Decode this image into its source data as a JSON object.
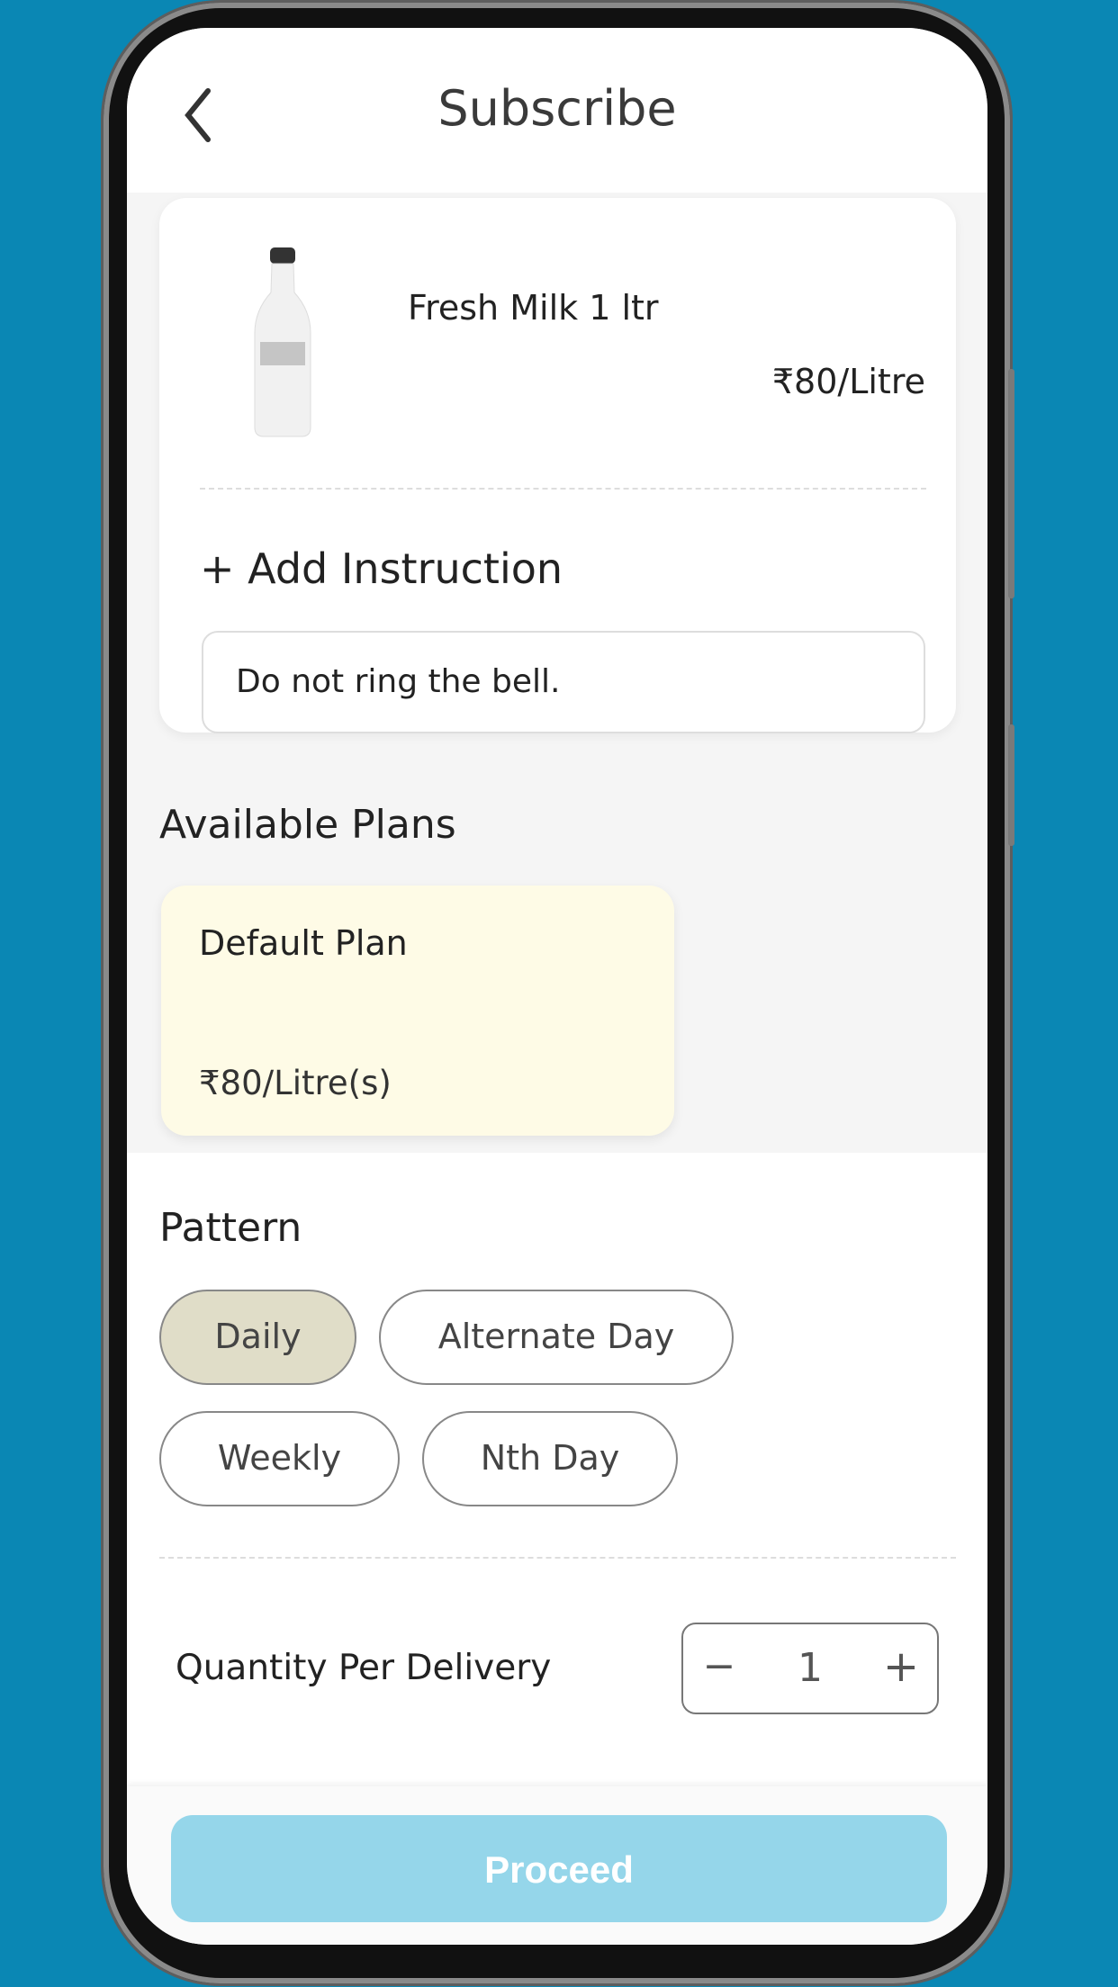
{
  "header": {
    "title": "Subscribe",
    "back_icon": "chevron-left-icon"
  },
  "product": {
    "name": "Fresh Milk 1 ltr",
    "price": "₹80/Litre",
    "image": "milk-bottle"
  },
  "instruction": {
    "add_label": "+ Add Instruction",
    "value": "Do not ring the bell."
  },
  "plans": {
    "heading": "Available Plans",
    "items": [
      {
        "name": "Default Plan",
        "price": "₹80/Litre(s)",
        "selected": true
      }
    ]
  },
  "pattern": {
    "heading": "Pattern",
    "options": [
      {
        "label": "Daily",
        "selected": true
      },
      {
        "label": "Alternate Day",
        "selected": false
      },
      {
        "label": "Weekly",
        "selected": false
      },
      {
        "label": "Nth Day",
        "selected": false
      }
    ]
  },
  "quantity": {
    "label": "Quantity Per Delivery",
    "value": "1",
    "minus": "−",
    "plus": "+"
  },
  "footer": {
    "proceed_label": "Proceed"
  },
  "colors": {
    "background": "#0a87b4",
    "proceed": "#95d6ea",
    "selected_chip": "#e0ddc8",
    "plan_card": "#fefbe6"
  }
}
